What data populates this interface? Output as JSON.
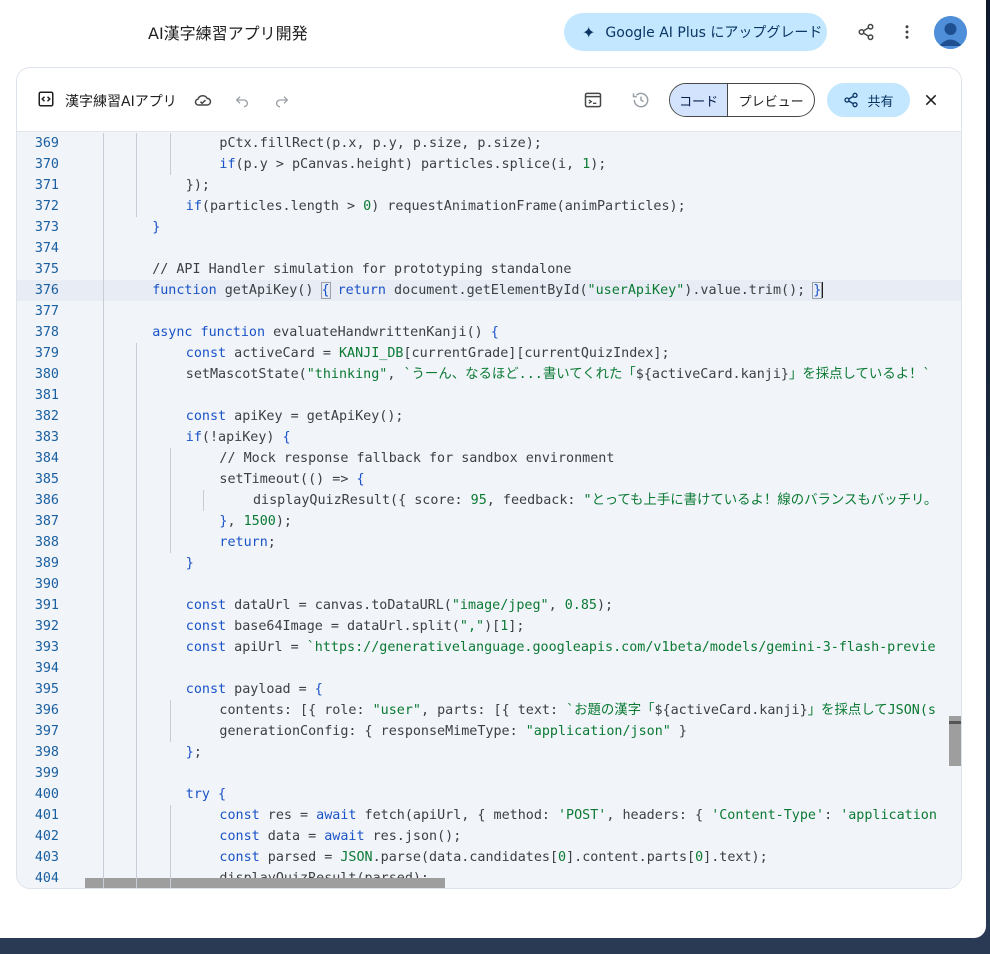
{
  "header": {
    "title": "AI漢字練習アプリ開発",
    "upgrade_label": "Google AI Plus にアップグレード"
  },
  "panel": {
    "doc_title": "漢字練習AIアプリ",
    "tab_code": "コード",
    "tab_preview": "プレビュー",
    "share_label": "共有"
  },
  "colors": {
    "accent_light": "#c2e7ff",
    "accent_text": "#0b3563",
    "keyword": "#1a53c7",
    "string": "#0b7a33",
    "line_number": "#1a5fa0"
  },
  "code": {
    "lines": [
      {
        "n": "369",
        "i": 4,
        "t": [
          [
            "pl",
            "pCtx.fillRect(p.x, p.y, p.size, p.size);"
          ]
        ]
      },
      {
        "n": "370",
        "i": 4,
        "t": [
          [
            "kw",
            "if"
          ],
          [
            "pl",
            "(p.y > pCanvas.height) particles.splice(i, "
          ],
          [
            "num",
            "1"
          ],
          [
            "pl",
            ");"
          ]
        ]
      },
      {
        "n": "371",
        "i": 3,
        "t": [
          [
            "pl",
            "});"
          ]
        ]
      },
      {
        "n": "372",
        "i": 3,
        "t": [
          [
            "kw",
            "if"
          ],
          [
            "pl",
            "(particles.length > "
          ],
          [
            "num",
            "0"
          ],
          [
            "pl",
            ") requestAnimationFrame(animParticles);"
          ]
        ]
      },
      {
        "n": "373",
        "i": 2,
        "t": [
          [
            "br1",
            "}"
          ]
        ]
      },
      {
        "n": "374",
        "i": 0,
        "t": []
      },
      {
        "n": "375",
        "i": 2,
        "t": [
          [
            "cm",
            "// API Handler simulation for prototyping standalone"
          ]
        ]
      },
      {
        "n": "376",
        "i": 2,
        "t": [
          [
            "kw",
            "function"
          ],
          [
            "pl",
            " getApiKey() "
          ],
          [
            "br1",
            "{"
          ],
          [
            "pl",
            " "
          ],
          [
            "kw",
            "return"
          ],
          [
            "pl",
            " document.getElementById("
          ],
          [
            "str",
            "\"userApiKey\""
          ],
          [
            "pl",
            ").value.trim(); "
          ],
          [
            "br1",
            "}"
          ]
        ]
      },
      {
        "n": "377",
        "i": 0,
        "t": []
      },
      {
        "n": "378",
        "i": 2,
        "t": [
          [
            "kw",
            "async function"
          ],
          [
            "pl",
            " evaluateHandwrittenKanji() "
          ],
          [
            "br1",
            "{"
          ]
        ]
      },
      {
        "n": "379",
        "i": 3,
        "t": [
          [
            "kw",
            "const"
          ],
          [
            "pl",
            " activeCard = "
          ],
          [
            "ty",
            "KANJI_DB"
          ],
          [
            "pl",
            "[currentGrade][currentQuizIndex];"
          ]
        ]
      },
      {
        "n": "380",
        "i": 3,
        "t": [
          [
            "pl",
            "setMascotState("
          ],
          [
            "str",
            "\"thinking\""
          ],
          [
            "pl",
            ", "
          ],
          [
            "str",
            "`うーん、なるほど...書いてくれた「"
          ],
          [
            "pl",
            "${activeCard.kanji}"
          ],
          [
            "str",
            "」を採点しているよ！`"
          ]
        ]
      },
      {
        "n": "381",
        "i": 0,
        "t": []
      },
      {
        "n": "382",
        "i": 3,
        "t": [
          [
            "kw",
            "const"
          ],
          [
            "pl",
            " apiKey = getApiKey();"
          ]
        ]
      },
      {
        "n": "383",
        "i": 3,
        "t": [
          [
            "kw",
            "if"
          ],
          [
            "pl",
            "(!apiKey) "
          ],
          [
            "br1",
            "{"
          ]
        ]
      },
      {
        "n": "384",
        "i": 4,
        "t": [
          [
            "cm",
            "// Mock response fallback for sandbox environment"
          ]
        ]
      },
      {
        "n": "385",
        "i": 4,
        "t": [
          [
            "pl",
            "setTimeout(() => "
          ],
          [
            "br1",
            "{"
          ]
        ]
      },
      {
        "n": "386",
        "i": 5,
        "t": [
          [
            "pl",
            "displayQuizResult({ score: "
          ],
          [
            "num",
            "95"
          ],
          [
            "pl",
            ", feedback: "
          ],
          [
            "str",
            "\"とっても上手に書けているよ！線のバランスもバッチリ。"
          ]
        ]
      },
      {
        "n": "387",
        "i": 4,
        "t": [
          [
            "br1",
            "}"
          ],
          [
            "pl",
            ", "
          ],
          [
            "num",
            "1500"
          ],
          [
            "pl",
            ");"
          ]
        ]
      },
      {
        "n": "388",
        "i": 4,
        "t": [
          [
            "kw",
            "return"
          ],
          [
            "pl",
            ";"
          ]
        ]
      },
      {
        "n": "389",
        "i": 3,
        "t": [
          [
            "br1",
            "}"
          ]
        ]
      },
      {
        "n": "390",
        "i": 0,
        "t": []
      },
      {
        "n": "391",
        "i": 3,
        "t": [
          [
            "kw",
            "const"
          ],
          [
            "pl",
            " dataUrl = canvas.toDataURL("
          ],
          [
            "str",
            "\"image/jpeg\""
          ],
          [
            "pl",
            ", "
          ],
          [
            "num",
            "0.85"
          ],
          [
            "pl",
            ");"
          ]
        ]
      },
      {
        "n": "392",
        "i": 3,
        "t": [
          [
            "kw",
            "const"
          ],
          [
            "pl",
            " base64Image = dataUrl.split("
          ],
          [
            "str",
            "\",\""
          ],
          [
            "pl",
            ")["
          ],
          [
            "num",
            "1"
          ],
          [
            "pl",
            "];"
          ]
        ]
      },
      {
        "n": "393",
        "i": 3,
        "t": [
          [
            "kw",
            "const"
          ],
          [
            "pl",
            " apiUrl = "
          ],
          [
            "str",
            "`https://generativelanguage.googleapis.com/v1beta/models/gemini-3-flash-previe"
          ]
        ]
      },
      {
        "n": "394",
        "i": 0,
        "t": []
      },
      {
        "n": "395",
        "i": 3,
        "t": [
          [
            "kw",
            "const"
          ],
          [
            "pl",
            " payload = "
          ],
          [
            "br1",
            "{"
          ]
        ]
      },
      {
        "n": "396",
        "i": 4,
        "t": [
          [
            "pl",
            "contents: [{ role: "
          ],
          [
            "str",
            "\"user\""
          ],
          [
            "pl",
            ", parts: [{ text: "
          ],
          [
            "str",
            "`お題の漢字「"
          ],
          [
            "pl",
            "${activeCard.kanji}"
          ],
          [
            "str",
            "」を採点してJSON(s"
          ]
        ]
      },
      {
        "n": "397",
        "i": 4,
        "t": [
          [
            "pl",
            "generationConfig: { responseMimeType: "
          ],
          [
            "str",
            "\"application/json\""
          ],
          [
            "pl",
            " }"
          ]
        ]
      },
      {
        "n": "398",
        "i": 3,
        "t": [
          [
            "br1",
            "}"
          ],
          [
            "pl",
            ";"
          ]
        ]
      },
      {
        "n": "399",
        "i": 0,
        "t": []
      },
      {
        "n": "400",
        "i": 3,
        "t": [
          [
            "kw",
            "try"
          ],
          [
            "pl",
            " "
          ],
          [
            "br1",
            "{"
          ]
        ]
      },
      {
        "n": "401",
        "i": 4,
        "t": [
          [
            "kw",
            "const"
          ],
          [
            "pl",
            " res = "
          ],
          [
            "kw",
            "await"
          ],
          [
            "pl",
            " fetch(apiUrl, { method: "
          ],
          [
            "str",
            "'POST'"
          ],
          [
            "pl",
            ", headers: { "
          ],
          [
            "str",
            "'Content-Type'"
          ],
          [
            "pl",
            ": "
          ],
          [
            "str",
            "'application"
          ]
        ]
      },
      {
        "n": "402",
        "i": 4,
        "t": [
          [
            "kw",
            "const"
          ],
          [
            "pl",
            " data = "
          ],
          [
            "kw",
            "await"
          ],
          [
            "pl",
            " res.json();"
          ]
        ]
      },
      {
        "n": "403",
        "i": 4,
        "t": [
          [
            "kw",
            "const"
          ],
          [
            "pl",
            " parsed = "
          ],
          [
            "ty",
            "JSON"
          ],
          [
            "pl",
            ".parse(data.candidates["
          ],
          [
            "num",
            "0"
          ],
          [
            "pl",
            "].content.parts["
          ],
          [
            "num",
            "0"
          ],
          [
            "pl",
            "].text);"
          ]
        ]
      },
      {
        "n": "404",
        "i": 4,
        "t": [
          [
            "pl",
            "displayQuizResult(parsed);"
          ]
        ]
      }
    ]
  }
}
